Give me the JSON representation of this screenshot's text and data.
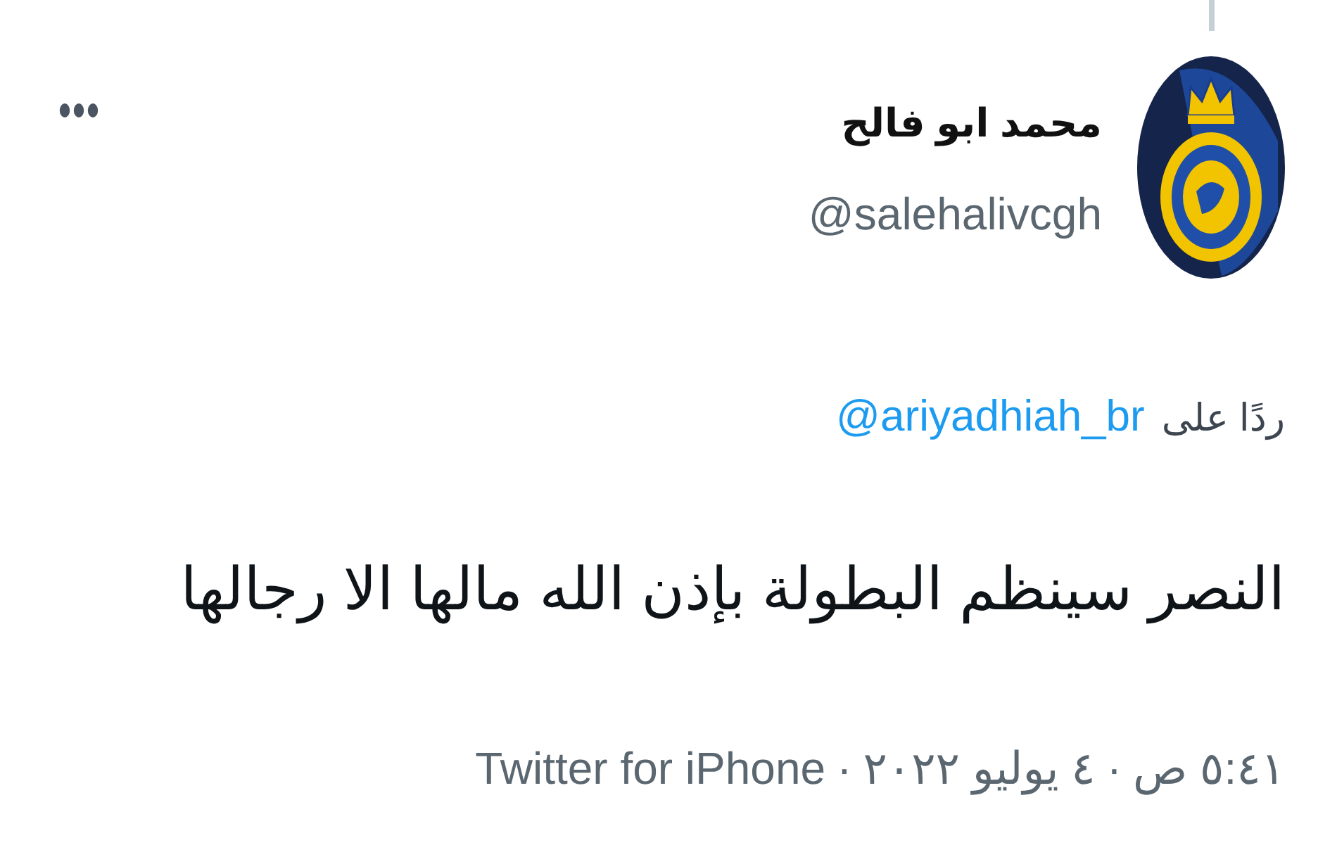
{
  "tweet": {
    "author": {
      "name": "محمد ابو فالح",
      "handle": "@salehalivcgh"
    },
    "reply_to": {
      "label": "ردًا على",
      "handle": "@ariyadhiah_br"
    },
    "text": "النصر سينظم البطولة بإذن الله مالها الا رجالها",
    "meta": [
      {
        "text": "٥:٤١ ص"
      },
      {
        "separator": "·",
        "text": "٤ يوليو ٢٠٢٢"
      },
      {
        "separator": "·",
        "text": "Twitter for iPhone"
      }
    ]
  }
}
